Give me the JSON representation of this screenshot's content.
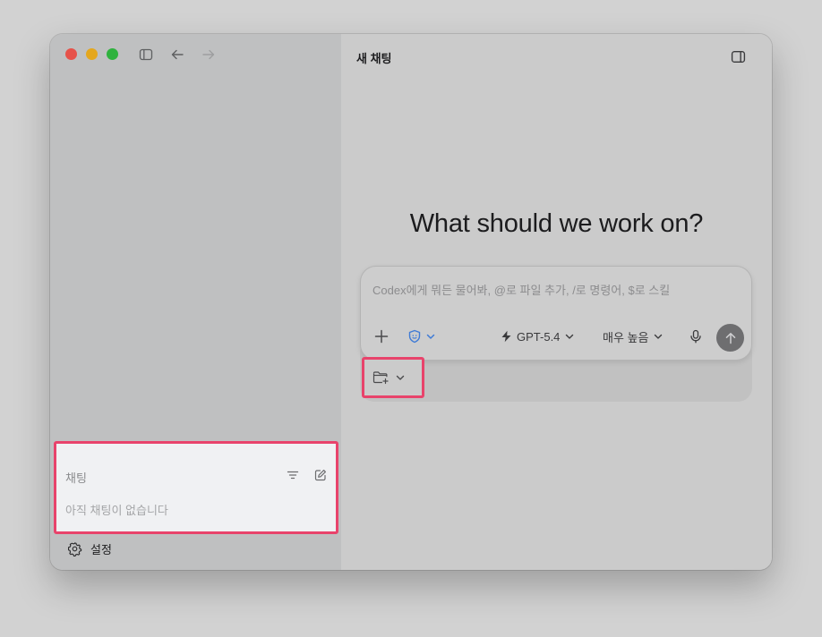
{
  "window": {
    "traffic_lights": [
      "close",
      "minimize",
      "zoom"
    ],
    "toolbar_icons": [
      "sidebar-toggle-icon",
      "back-arrow-icon",
      "forward-arrow-icon"
    ]
  },
  "sidebar": {
    "chats_title": "채팅",
    "chats_empty": "아직 채팅이 없습니다",
    "chats_icons": [
      "filter-icon",
      "compose-icon"
    ],
    "settings_label": "설정"
  },
  "main": {
    "title": "새 채팅",
    "hero": "What should we work on?",
    "composer": {
      "placeholder": "Codex에게 뭐든 물어봐, @로 파일 추가, /로 명령어, $로 스킬",
      "model": "GPT-5.4",
      "reasoning": "매우 높음"
    }
  },
  "colors": {
    "highlight": "#e8436b",
    "accent": "#3f7bd6",
    "send_button": "#6e6e70"
  }
}
